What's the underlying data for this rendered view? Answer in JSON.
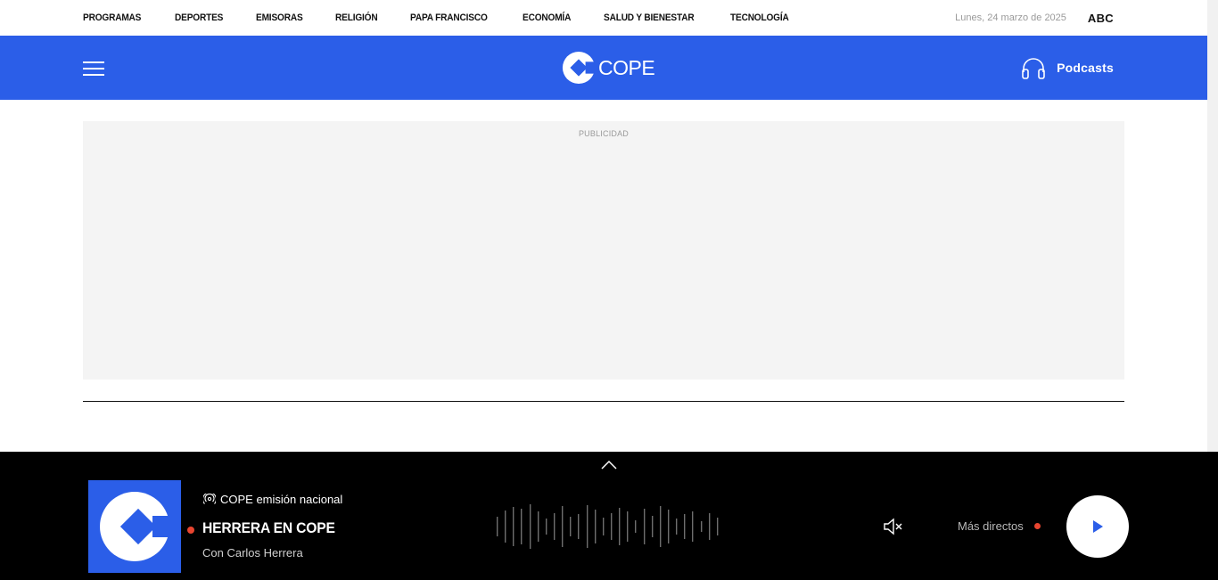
{
  "topnav": {
    "items": [
      {
        "label": "PROGRAMAS"
      },
      {
        "label": "DEPORTES"
      },
      {
        "label": "EMISORAS"
      },
      {
        "label": "RELIGIÓN"
      },
      {
        "label": "PAPA FRANCISCO"
      },
      {
        "label": "ECONOMÍA"
      },
      {
        "label": "SALUD Y BIENESTAR"
      },
      {
        "label": "TECNOLOGÍA"
      }
    ],
    "date": "Lunes, 24 marzo de 2025",
    "abc": "ABC"
  },
  "header": {
    "logo_text": "COPE",
    "podcasts_label": "Podcasts",
    "icons": {
      "menu": "hamburger-menu-icon",
      "podcasts": "headphones-icon",
      "logo": "cope-logo-icon"
    }
  },
  "ad": {
    "label": "PUBLICIDAD"
  },
  "player": {
    "station_name": "COPE emisión nacional",
    "show_title": "HERRERA EN COPE",
    "host": "Con Carlos Herrera",
    "more_live_label": "Más directos",
    "icons": {
      "collapse": "chevron-up-icon",
      "station": "broadcast-icon",
      "mute": "speaker-muted-icon",
      "play": "play-icon"
    }
  },
  "colors": {
    "brand_blue": "#2b5ee8",
    "live_red": "#e84530",
    "player_bg": "#000000",
    "ad_bg": "#f4f4f4"
  }
}
